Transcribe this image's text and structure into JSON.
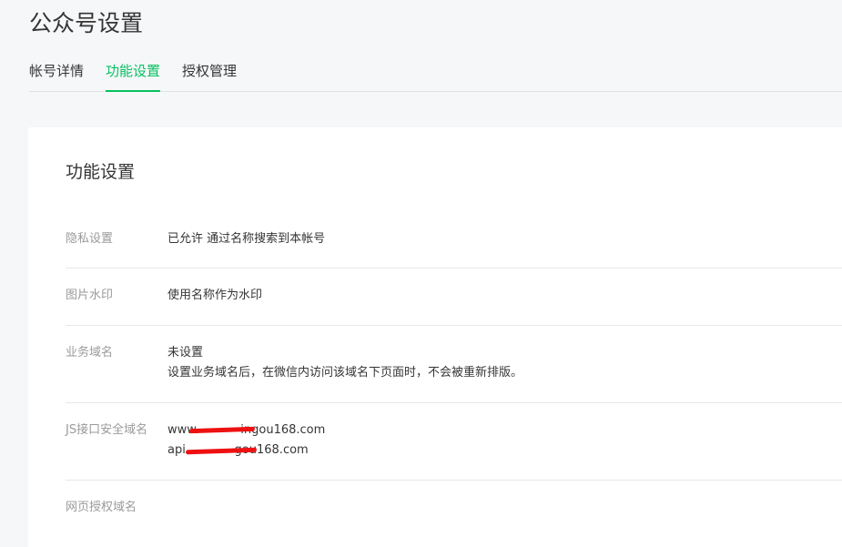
{
  "page": {
    "title": "公众号设置"
  },
  "tabs": [
    {
      "label": "帐号详情",
      "active": false
    },
    {
      "label": "功能设置",
      "active": true
    },
    {
      "label": "授权管理",
      "active": false
    }
  ],
  "card": {
    "title": "功能设置",
    "rows": [
      {
        "label": "隐私设置",
        "value_lines": [
          "已允许 通过名称搜索到本帐号"
        ]
      },
      {
        "label": "图片水印",
        "value_lines": [
          "使用名称作为水印"
        ]
      },
      {
        "label": "业务域名",
        "value_lines": [
          "未设置",
          "设置业务域名后，在微信内访问该域名下页面时，不会被重新排版。"
        ]
      },
      {
        "label": "JS接口安全域名",
        "value_lines": [
          "www.           ingou168.com",
          "api.            gou168.com"
        ]
      },
      {
        "label": "网页授权域名",
        "value_lines": []
      }
    ]
  },
  "colors": {
    "accent": "#07c160",
    "background": "#f6f7f9",
    "label": "#9a9a9a",
    "text": "#353535",
    "redaction": "#ee1111"
  }
}
